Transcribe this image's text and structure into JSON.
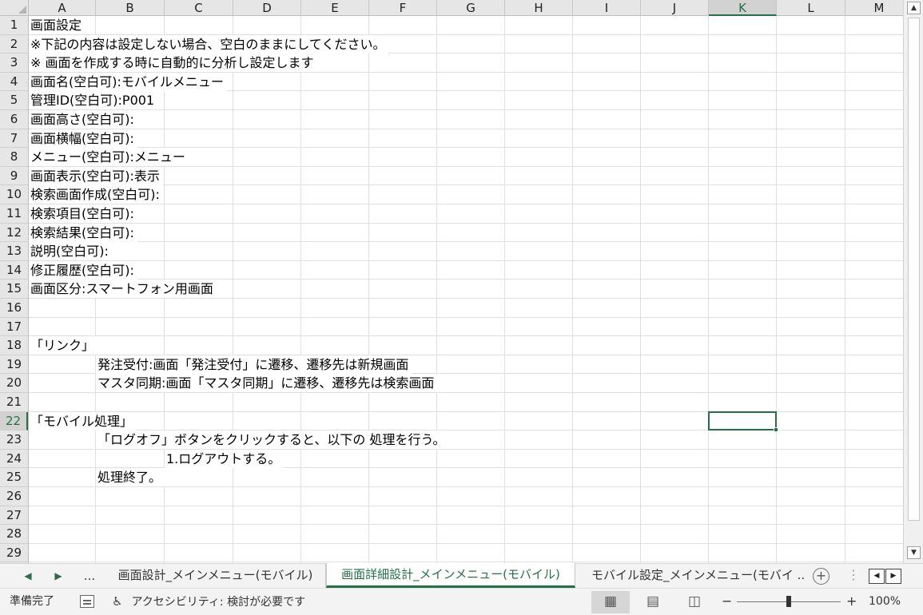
{
  "columns": [
    "A",
    "B",
    "C",
    "D",
    "E",
    "F",
    "G",
    "H",
    "I",
    "J",
    "K",
    "L",
    "M"
  ],
  "active_cell": {
    "col": "K",
    "row": 22
  },
  "rows": [
    {
      "row": "1",
      "text": "画面設定",
      "indent": 0
    },
    {
      "row": "2",
      "text": "※下記の内容は設定しない場合、空白のままにしてください。",
      "indent": 0
    },
    {
      "row": "3",
      "text": "※ 画面を作成する時に自動的に分析し設定します",
      "indent": 0
    },
    {
      "row": "4",
      "text": "画面名(空白可):モバイルメニュー",
      "indent": 0
    },
    {
      "row": "5",
      "text": "管理ID(空白可):P001",
      "indent": 0
    },
    {
      "row": "6",
      "text": "画面高さ(空白可):",
      "indent": 0
    },
    {
      "row": "7",
      "text": "画面横幅(空白可):",
      "indent": 0
    },
    {
      "row": "8",
      "text": "メニュー(空白可):メニュー",
      "indent": 0
    },
    {
      "row": "9",
      "text": "画面表示(空白可):表示",
      "indent": 0
    },
    {
      "row": "10",
      "text": "検索画面作成(空白可):",
      "indent": 0
    },
    {
      "row": "11",
      "text": "検索項目(空白可):",
      "indent": 0
    },
    {
      "row": "12",
      "text": "検索結果(空白可):",
      "indent": 0
    },
    {
      "row": "13",
      "text": "説明(空白可):",
      "indent": 0
    },
    {
      "row": "14",
      "text": "修正履歴(空白可):",
      "indent": 0
    },
    {
      "row": "15",
      "text": "画面区分:スマートフォン用画面",
      "indent": 0
    },
    {
      "row": "16",
      "text": "",
      "indent": 0
    },
    {
      "row": "17",
      "text": "",
      "indent": 0
    },
    {
      "row": "18",
      "text": "「リンク」",
      "indent": 0
    },
    {
      "row": "19",
      "text": "発注受付:画面「発注受付」に遷移、遷移先は新規画面",
      "indent": 1
    },
    {
      "row": "20",
      "text": "マスタ同期:画面「マスタ同期」に遷移、遷移先は検索画面",
      "indent": 1
    },
    {
      "row": "21",
      "text": "",
      "indent": 0
    },
    {
      "row": "22",
      "text": "「モバイル処理」",
      "indent": 0
    },
    {
      "row": "23",
      "text": "「ログオフ」ボタンをクリックすると、以下の 処理を行う。",
      "indent": 1
    },
    {
      "row": "24",
      "text": "1.ログアウトする。",
      "indent": 2
    },
    {
      "row": "25",
      "text": "処理終了。",
      "indent": 1
    },
    {
      "row": "26",
      "text": "",
      "indent": 0
    },
    {
      "row": "27",
      "text": "",
      "indent": 0
    },
    {
      "row": "28",
      "text": "",
      "indent": 0
    },
    {
      "row": "29",
      "text": "",
      "indent": 0
    }
  ],
  "sheet_nav": {
    "prev": "◀",
    "next": "▶",
    "more": "..."
  },
  "tabs": [
    {
      "label": "画面設計_メインメニュー(モバイル)",
      "active": false
    },
    {
      "label": "画面詳細設計_メインメニュー(モバイル)",
      "active": true
    },
    {
      "label": "モバイル設定_メインメニュー(モバイ ...",
      "active": false
    }
  ],
  "add_sheet": "+",
  "tab_more": "⋮",
  "status": {
    "ready": "準備完了",
    "accessibility": "アクセシビリティ: 検討が必要です",
    "zoom_minus": "−",
    "zoom_plus": "+",
    "zoom_level": "100%",
    "zoom_percent": 100
  },
  "colors": {
    "accent": "#217346",
    "header_bg": "#e6e6e6",
    "gridline": "#e0e0e0"
  }
}
